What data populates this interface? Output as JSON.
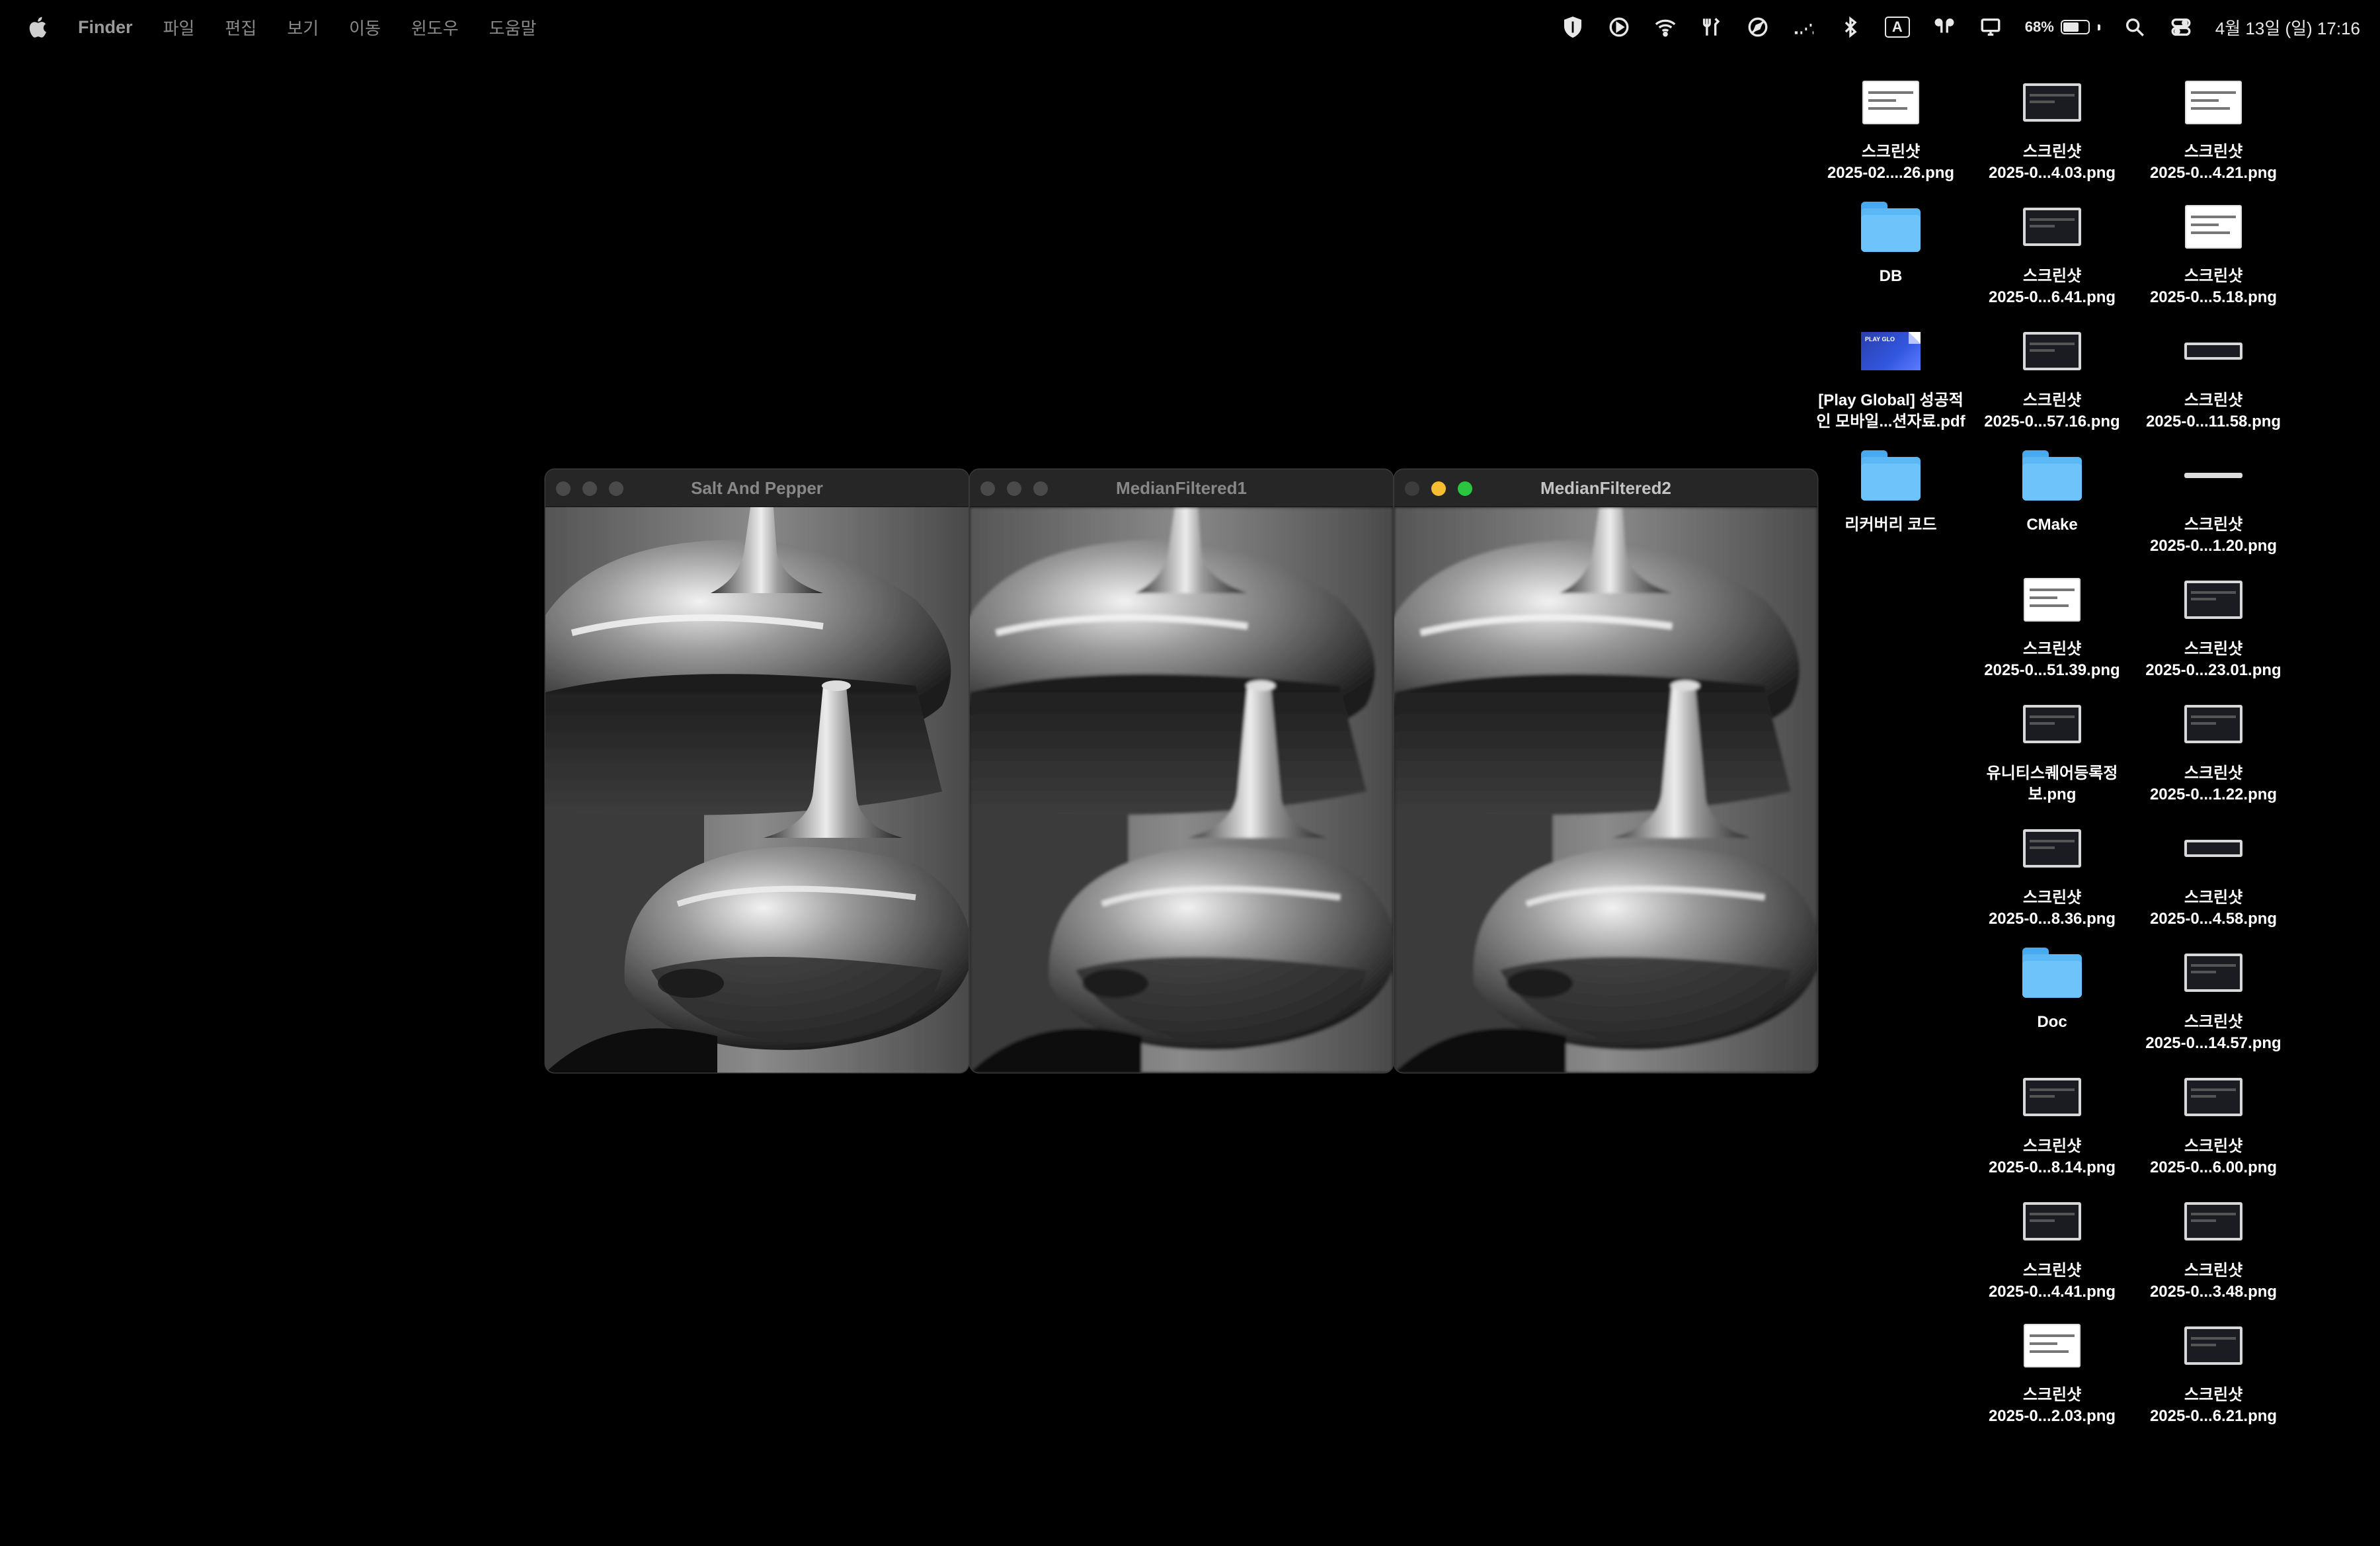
{
  "menubar": {
    "app": "Finder",
    "items": [
      "파일",
      "편집",
      "보기",
      "이동",
      "윈도우",
      "도움말"
    ],
    "input_source": "A",
    "battery_percent": "68%",
    "battery_level": 0.68,
    "clock": "4월 13일 (일) 17:16"
  },
  "windows": [
    {
      "title": "Salt And Pepper",
      "active": false
    },
    {
      "title": "MedianFiltered1",
      "active": false
    },
    {
      "title": "MedianFiltered2",
      "active": true
    }
  ],
  "desktop": {
    "col1": [
      {
        "label": "스크린샷\n2025-02....26.png",
        "kind": "shot-light"
      },
      {
        "label": "DB",
        "kind": "folder"
      },
      {
        "label": "[Play Global] 성공적\n인 모바일...션자료.pdf",
        "kind": "pdf",
        "thumb_text": "PLAY GLO"
      },
      {
        "label": "리커버리 코드",
        "kind": "folder"
      }
    ],
    "col2": [
      {
        "label": "스크린샷\n2025-0...4.03.png",
        "kind": "shot-dark"
      },
      {
        "label": "스크린샷\n2025-0...6.41.png",
        "kind": "shot-dark"
      },
      {
        "label": "스크린샷\n2025-0...57.16.png",
        "kind": "shot-dark"
      },
      {
        "label": "CMake",
        "kind": "folder"
      },
      {
        "label": "스크린샷\n2025-0...51.39.png",
        "kind": "shot-light"
      },
      {
        "label": "유니티스퀘어등록정\n보.png",
        "kind": "shot-dark"
      },
      {
        "label": "스크린샷\n2025-0...8.36.png",
        "kind": "shot-dark"
      },
      {
        "label": "Doc",
        "kind": "folder"
      },
      {
        "label": "스크린샷\n2025-0...8.14.png",
        "kind": "shot-dark"
      },
      {
        "label": "스크린샷\n2025-0...4.41.png",
        "kind": "shot-dark"
      },
      {
        "label": "스크린샷\n2025-0...2.03.png",
        "kind": "shot-light"
      }
    ],
    "col3": [
      {
        "label": "스크린샷\n2025-0...4.21.png",
        "kind": "shot-light"
      },
      {
        "label": "스크린샷\n2025-0...5.18.png",
        "kind": "shot-light"
      },
      {
        "label": "스크린샷\n2025-0...11.58.png",
        "kind": "shot-wide"
      },
      {
        "label": "스크린샷\n2025-0...1.20.png",
        "kind": "shot-line"
      },
      {
        "label": "스크린샷\n2025-0...23.01.png",
        "kind": "shot-dark"
      },
      {
        "label": "스크린샷\n2025-0...1.22.png",
        "kind": "shot-dark"
      },
      {
        "label": "스크린샷\n2025-0...4.58.png",
        "kind": "shot-wide"
      },
      {
        "label": "스크린샷\n2025-0...14.57.png",
        "kind": "shot-dark"
      },
      {
        "label": "스크린샷\n2025-0...6.00.png",
        "kind": "shot-dark"
      },
      {
        "label": "스크린샷\n2025-0...3.48.png",
        "kind": "shot-dark"
      },
      {
        "label": "스크린샷\n2025-0...6.21.png",
        "kind": "shot-dark"
      }
    ]
  }
}
